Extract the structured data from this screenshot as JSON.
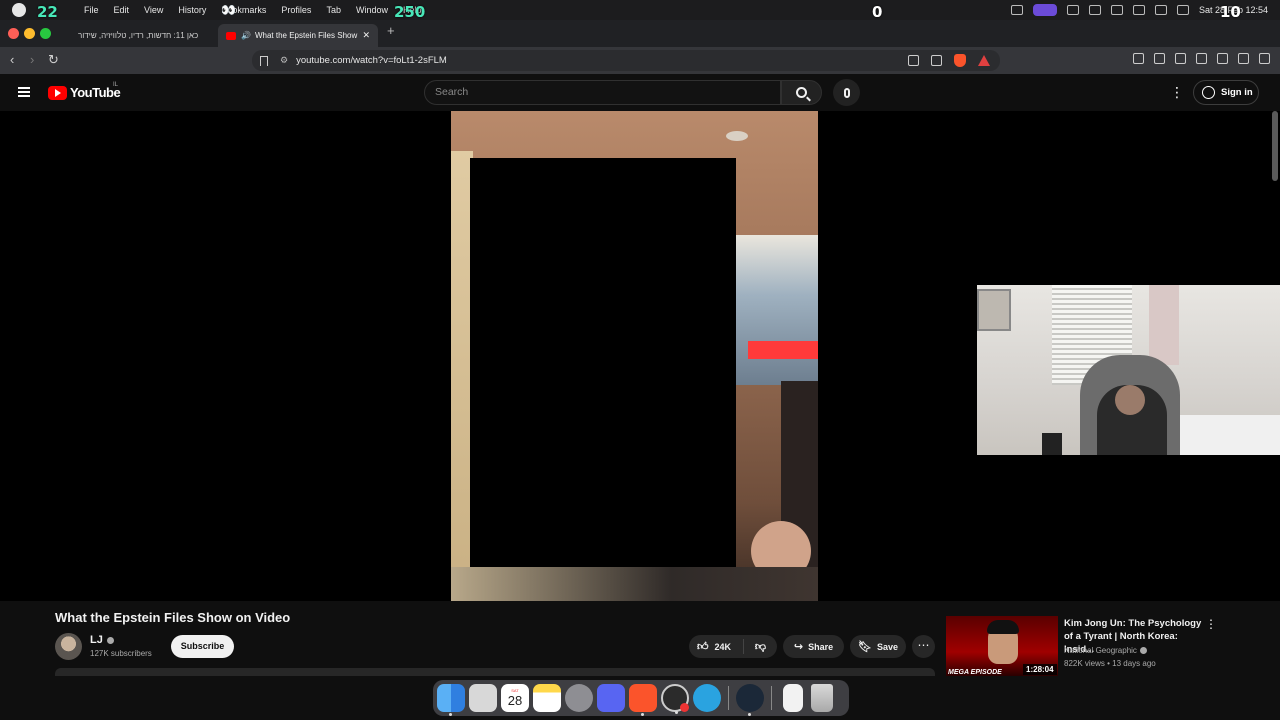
{
  "menubar": {
    "items": [
      "File",
      "Edit",
      "View",
      "History",
      "Bookmarks",
      "Profiles",
      "Tab",
      "Window",
      "Help"
    ],
    "datetime": "Sat 28 Feb  12:54"
  },
  "overlay": {
    "counter_a": "22",
    "counter_b": "250",
    "counter_c": "0",
    "counter_d": "10",
    "eyes": "👀"
  },
  "browser": {
    "tabs": [
      {
        "title": "כאן 11: חדשות, רדיו, טלוויזיה, שידור",
        "active": false
      },
      {
        "title": "What the Epstein Files Show",
        "active": true
      }
    ],
    "url": "youtube.com/watch?v=foLt1-2sFLM"
  },
  "youtube": {
    "logo_text": "YouTube",
    "country": "IL",
    "search_placeholder": "Search",
    "sign_in": "Sign in"
  },
  "video": {
    "title": "What the Epstein Files Show on Video",
    "channel": "LJ",
    "subscribers": "127K subscribers",
    "subscribe_label": "Subscribe",
    "likes": "24K",
    "share_label": "Share",
    "save_label": "Save"
  },
  "recommendation": {
    "title": "Kim Jong Un: The Psychology of a Tyrant | North Korea: Insid...",
    "channel": "National Geographic",
    "meta": "822K views • 13 days ago",
    "duration": "1:28:04",
    "thumb_label": "MEGA EPISODE"
  },
  "dock": {
    "calendar_day": "28",
    "calendar_dow": "SAT"
  },
  "colors": {
    "youtube_red": "#ff0000",
    "bg": "#0f0f0f",
    "overlay_green": "#48e7b8"
  }
}
